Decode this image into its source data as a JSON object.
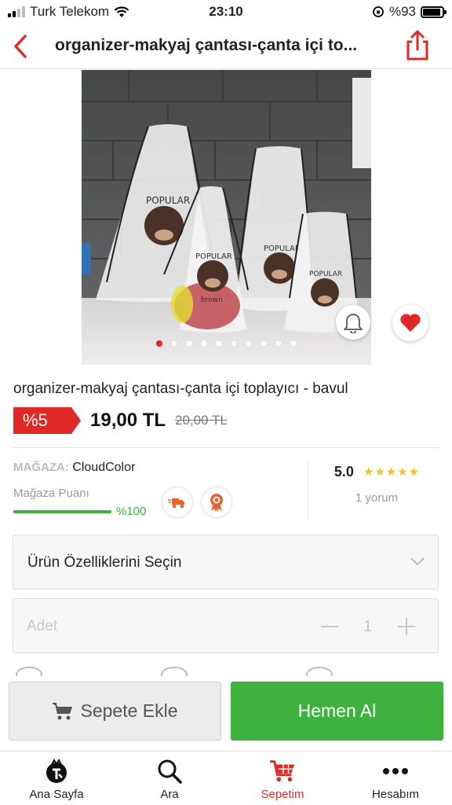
{
  "status_bar": {
    "carrier": "Turk Telekom",
    "time": "23:10",
    "battery": "%93",
    "battery_level": 0.93
  },
  "header": {
    "title": "organizer-makyaj çantası-çanta içi to..."
  },
  "gallery": {
    "image_count": 10,
    "active_index": 0,
    "bag_print": "POPULAR",
    "bag_print_sub": "brown"
  },
  "product": {
    "title": "organizer-makyaj çantası-çanta içi toplayıcı - bavul",
    "discount": "%5",
    "price": "19,00 TL",
    "old_price": "20,00 TL"
  },
  "store": {
    "label": "MAĞAZA:",
    "name": "CloudColor",
    "score_label": "Mağaza Puanı",
    "score_value": "%100",
    "score_fraction": 1.0,
    "rating": "5.0",
    "stars": 5,
    "review_count": "1 yorum"
  },
  "options": {
    "select_label": "Ürün Özelliklerini Seçin",
    "qty_placeholder": "Adet",
    "qty_value": "1"
  },
  "actions": {
    "add_to_cart": "Sepete Ekle",
    "buy_now": "Hemen Al"
  },
  "tabs": [
    {
      "label": "Ana Sayfa",
      "icon": "home-logo-icon"
    },
    {
      "label": "Ara",
      "icon": "search-icon"
    },
    {
      "label": "Sepetim",
      "icon": "cart-icon"
    },
    {
      "label": "Hesabım",
      "icon": "more-icon"
    }
  ],
  "colors": {
    "accent_red": "#e02927",
    "accent_green": "#3fb13f",
    "star": "#f3c12a"
  }
}
